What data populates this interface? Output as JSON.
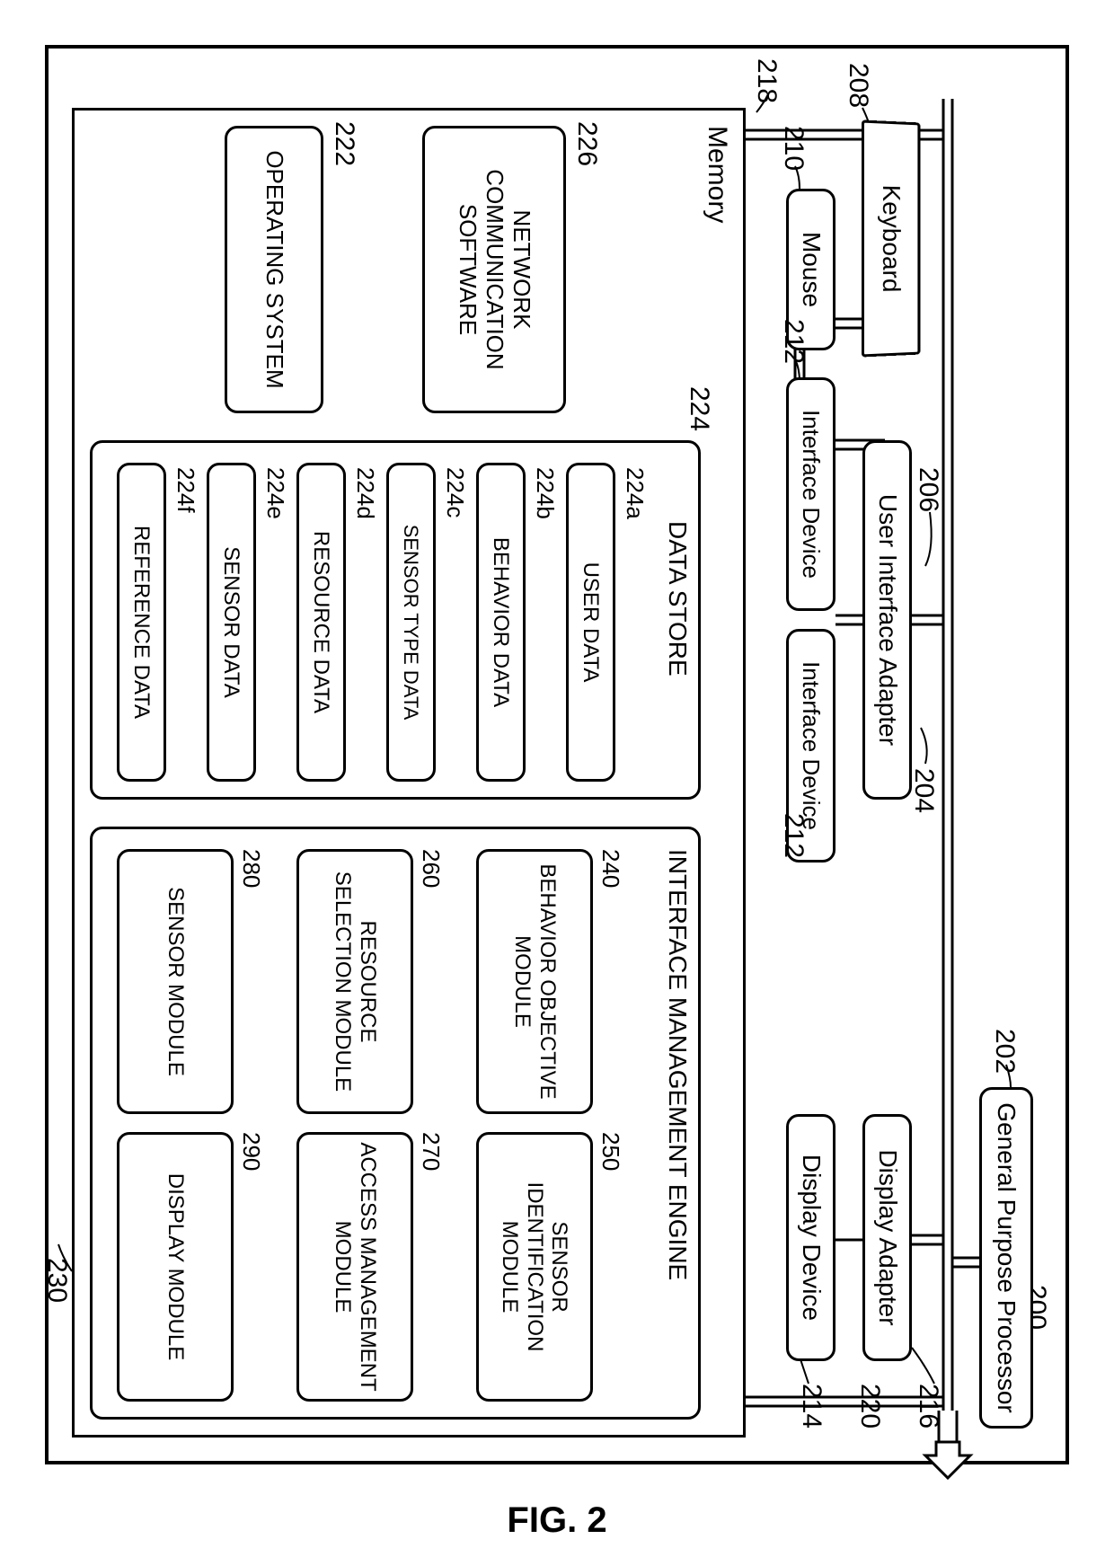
{
  "figure_label": "FIG. 2",
  "system_ref": "200",
  "processor": {
    "label": "General Purpose Processor",
    "ref": "202"
  },
  "ui_adapter": {
    "label": "User Interface Adapter",
    "ref": "204"
  },
  "ui_adapter_line_ref": "206",
  "display_adapter": {
    "label": "Display Adapter",
    "ref": "216"
  },
  "display_device": {
    "label": "Display Device",
    "ref": "214"
  },
  "display_link_ref": "220",
  "keyboard": {
    "label": "Keyboard",
    "ref": "208"
  },
  "mouse": {
    "label": "Mouse",
    "ref": "210"
  },
  "interface_device_a": {
    "label": "Interface Device",
    "ref": "212"
  },
  "interface_device_b": {
    "label": "Interface Device",
    "ref": "212"
  },
  "memory": {
    "label": "Memory",
    "ref": "218"
  },
  "net_sw": {
    "label": "NETWORK COMMUNICATION SOFTWARE",
    "ref": "226"
  },
  "os": {
    "label": "OPERATING SYSTEM",
    "ref": "222"
  },
  "data_store": {
    "title": "DATA STORE",
    "ref": "224",
    "items": [
      {
        "ref": "224a",
        "label": "USER DATA"
      },
      {
        "ref": "224b",
        "label": "BEHAVIOR DATA"
      },
      {
        "ref": "224c",
        "label": "SENSOR TYPE DATA"
      },
      {
        "ref": "224d",
        "label": "RESOURCE DATA"
      },
      {
        "ref": "224e",
        "label": "SENSOR DATA"
      },
      {
        "ref": "224f",
        "label": "REFERENCE DATA"
      }
    ]
  },
  "engine": {
    "title": "INTERFACE MANAGEMENT ENGINE",
    "ref": "230",
    "modules": [
      {
        "ref": "240",
        "label": "BEHAVIOR OBJECTIVE MODULE"
      },
      {
        "ref": "250",
        "label": "SENSOR IDENTIFICATION MODULE"
      },
      {
        "ref": "260",
        "label": "RESOURCE SELECTION MODULE"
      },
      {
        "ref": "270",
        "label": "ACCESS MANAGEMENT MODULE"
      },
      {
        "ref": "280",
        "label": "SENSOR MODULE"
      },
      {
        "ref": "290",
        "label": "DISPLAY MODULE"
      }
    ]
  }
}
